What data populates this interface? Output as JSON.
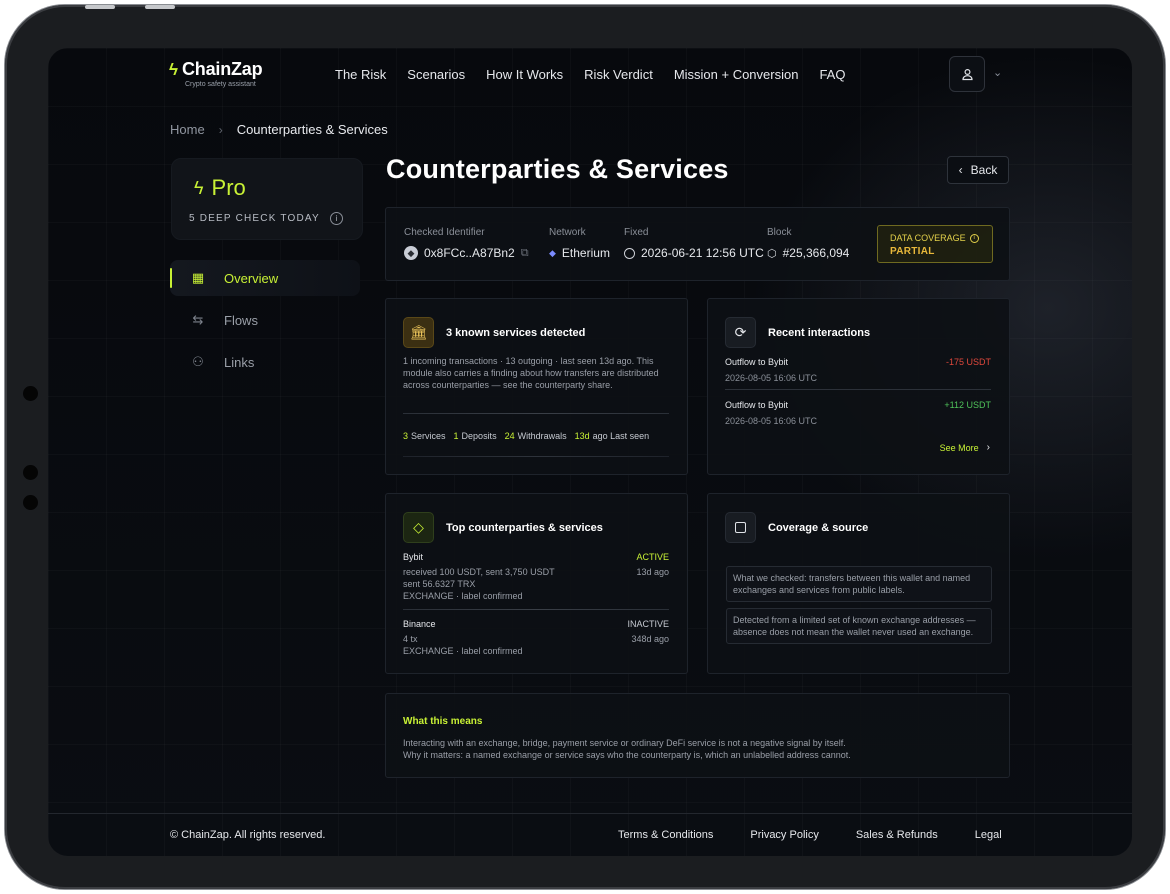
{
  "brand": {
    "name": "ChainZap",
    "tagline": "Crypto safety assistant"
  },
  "nav": [
    "The Risk",
    "Scenarios",
    "How It Works",
    "Risk Verdict",
    "Mission + Conversion",
    "FAQ"
  ],
  "breadcrumb": {
    "home": "Home",
    "current": "Counterparties & Services"
  },
  "plan": {
    "name": "Pro",
    "subtitle": "5 DEEP CHECK TODAY"
  },
  "sidebar": [
    {
      "label": "Overview",
      "icon": "grid-icon"
    },
    {
      "label": "Flows",
      "icon": "arrows-icon"
    },
    {
      "label": "Links",
      "icon": "users-icon"
    }
  ],
  "page": {
    "title": "Counterparties & Services",
    "back": "Back"
  },
  "meta": {
    "identifier_label": "Checked Identifier",
    "identifier": "0x8FCc..A87Bn2",
    "network_label": "Network",
    "network": "Etherium",
    "fixed_label": "Fixed",
    "fixed": "2026-06-21 12:56 UTC",
    "block_label": "Block",
    "block": "#25,366,094",
    "coverage_label": "DATA COVERAGE",
    "coverage_value": "PARTIAL"
  },
  "services": {
    "title": "3 known services detected",
    "description": "1 incoming transactions · 13 outgoing · last seen 13d ago. This module also carries a finding about how transfers are distributed across counterparties — see the counterparty share.",
    "stats": [
      {
        "num": "3",
        "label": "Services"
      },
      {
        "num": "1",
        "label": "Deposits"
      },
      {
        "num": "24",
        "label": "Withdrawals"
      },
      {
        "num": "13d",
        "label": "ago Last seen"
      }
    ]
  },
  "recent": {
    "title": "Recent interactions",
    "items": [
      {
        "title": "Outflow to Bybit",
        "date": "2026-08-05 16:06 UTC",
        "amount": "-175 USDT",
        "direction": "negative"
      },
      {
        "title": "Outflow to Bybit",
        "date": "2026-08-05 16:06 UTC",
        "amount": "+112 USDT",
        "direction": "positive"
      }
    ],
    "see_more": "See More"
  },
  "top_counterparties": {
    "title": "Top counterparties & services",
    "items": [
      {
        "name": "Bybit",
        "line1": "received 100 USDT, sent 3,750 USDT",
        "line2": "sent 56.6327 TRX",
        "line3": "EXCHANGE · label confirmed",
        "status": "ACTIVE",
        "ago": "13d ago"
      },
      {
        "name": "Binance",
        "line1": "4 tx",
        "line2": "EXCHANGE · label confirmed",
        "status": "INACTIVE",
        "ago": "348d ago"
      }
    ]
  },
  "coverage": {
    "title": "Coverage & source",
    "checked": "What we checked: transfers between this wallet and named exchanges and services from public labels.",
    "limits": "Detected from a limited set of known exchange addresses — absence does not mean the wallet never used an exchange."
  },
  "meaning": {
    "title": "What this means",
    "line1": "Interacting with an exchange, bridge, payment service or ordinary DeFi service is not a negative signal by itself.",
    "line2": "Why it matters: a named exchange or service says who the counterparty is, which an unlabelled address cannot."
  },
  "footer": {
    "copyright": "© ChainZap. All rights reserved.",
    "links": [
      "Terms & Conditions",
      "Privacy Policy",
      "Sales & Refunds",
      "Legal"
    ]
  },
  "colors": {
    "accent": "#c8f135",
    "negative": "#e0483c",
    "positive": "#4fc35a",
    "warning": "#e3d14a"
  }
}
